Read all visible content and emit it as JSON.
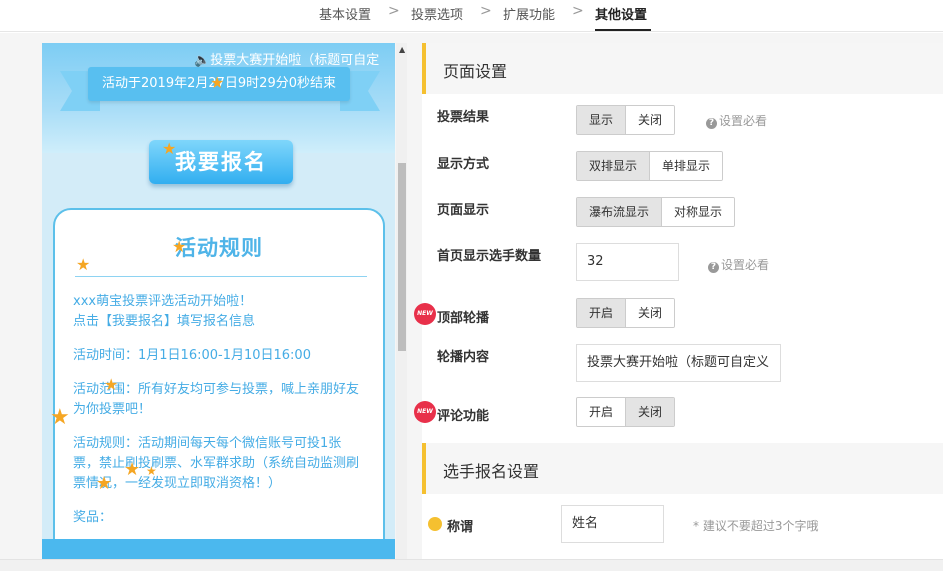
{
  "nav": {
    "items": [
      {
        "label": "基本设置"
      },
      {
        "label": "投票选项"
      },
      {
        "label": "扩展功能"
      },
      {
        "label": "其他设置"
      }
    ],
    "separator": ">"
  },
  "preview": {
    "marquee": "投票大赛开始啦（标题可自定",
    "countdown": "活动于2019年2月27日9时29分0秒结束",
    "signup_button": "我要报名",
    "rules_title": "活动规则",
    "rules": [
      "xxx萌宝投票评选活动开始啦！",
      "点击【我要报名】填写报名信息",
      "活动时间：1月1日16:00-1月10日16:00",
      "活动范围：所有好友均可参与投票，喊上亲朋好友为你投票吧！",
      "活动规则：活动期间每天每个微信账号可投1张票，禁止刷投刷票、水军群求助（系统自动监测刷票情况，一经发现立即取消资格！）",
      "奖品："
    ]
  },
  "page_settings": {
    "title": "页面设置",
    "vote_result": {
      "label": "投票结果",
      "options": [
        "显示",
        "关闭"
      ],
      "selected": "显示",
      "hint": "设置必看"
    },
    "display_mode": {
      "label": "显示方式",
      "options": [
        "双排显示",
        "单排显示"
      ],
      "selected": "双排显示"
    },
    "page_display": {
      "label": "页面显示",
      "options": [
        "瀑布流显示",
        "对称显示"
      ],
      "selected": "瀑布流显示"
    },
    "home_count": {
      "label": "首页显示选手数量",
      "value": "32",
      "hint": "设置必看"
    },
    "top_carousel": {
      "label": "顶部轮播",
      "options": [
        "开启",
        "关闭"
      ],
      "selected": "开启",
      "badge": "NEW"
    },
    "carousel_content": {
      "label": "轮播内容",
      "value": "投票大赛开始啦（标题可自定义"
    },
    "comments": {
      "label": "评论功能",
      "options": [
        "开启",
        "关闭"
      ],
      "selected": "关闭",
      "badge": "NEW"
    }
  },
  "signup_settings": {
    "title": "选手报名设置",
    "name_field": {
      "label": "称谓",
      "value": "姓名",
      "hint": "* 建议不要超过3个字哦"
    }
  },
  "colors": {
    "accent": "#f5c030",
    "preview_blue": "#58bff0",
    "badge_red": "#e8304a"
  }
}
